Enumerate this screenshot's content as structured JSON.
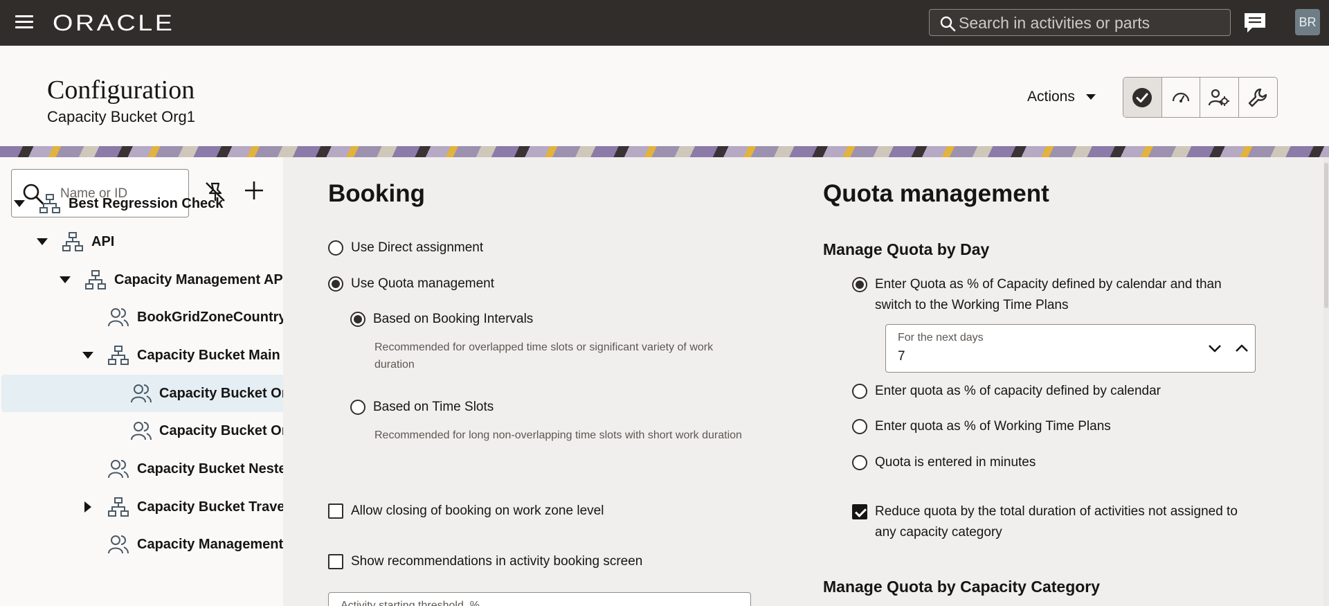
{
  "topbar": {
    "logo": "ORACLE",
    "search_placeholder": "Search in activities or parts",
    "avatar_initials": "BR"
  },
  "header": {
    "title": "Configuration",
    "subtitle": "Capacity Bucket Org1",
    "actions_label": "Actions"
  },
  "tree": {
    "search_placeholder": "Name or ID",
    "items": [
      {
        "label": "Best Regression Check",
        "type": "org",
        "expanded": true
      },
      {
        "label": "API",
        "type": "org",
        "expanded": true
      },
      {
        "label": "Capacity Management API (",
        "type": "org",
        "expanded": true
      },
      {
        "label": "BookGridZoneCountryB",
        "type": "bucket"
      },
      {
        "label": "Capacity Bucket Main",
        "type": "org",
        "expanded": true
      },
      {
        "label": "Capacity Bucket Org",
        "type": "bucket",
        "selected": true
      },
      {
        "label": "Capacity Bucket Org",
        "type": "bucket"
      },
      {
        "label": "Capacity Bucket Nested",
        "type": "bucket"
      },
      {
        "label": "Capacity Bucket Travel T",
        "type": "org",
        "expanded": false
      },
      {
        "label": "Capacity Management A",
        "type": "bucket"
      }
    ]
  },
  "booking": {
    "title": "Booking",
    "opt_direct": "Use Direct assignment",
    "opt_quota": "Use Quota management",
    "opt_intervals": "Based on Booking Intervals",
    "help_intervals": "Recommended for overlapped time slots or significant variety of work duration",
    "opt_slots": "Based on Time Slots",
    "help_slots": "Recommended for long non-overlapping time slots with short work duration",
    "chk_closing": "Allow closing of booking on work zone level",
    "chk_recommend": "Show recommendations in activity booking screen",
    "threshold_label": "Activity starting threshold, %"
  },
  "quota": {
    "title": "Quota management",
    "by_day": "Manage Quota by Day",
    "opt_pct_calendar_then_wtp": "Enter Quota as % of Capacity defined by calendar and than switch to the Working Time Plans",
    "next_days_label": "For the next days",
    "next_days_value": "7",
    "opt_pct_calendar": "Enter quota as % of capacity defined by calendar",
    "opt_pct_wtp": "Enter quota as % of Working Time Plans",
    "opt_minutes": "Quota is entered in minutes",
    "chk_reduce": "Reduce quota by the total duration of activities not assigned to any capacity category",
    "by_category": "Manage Quota by Capacity Category"
  }
}
